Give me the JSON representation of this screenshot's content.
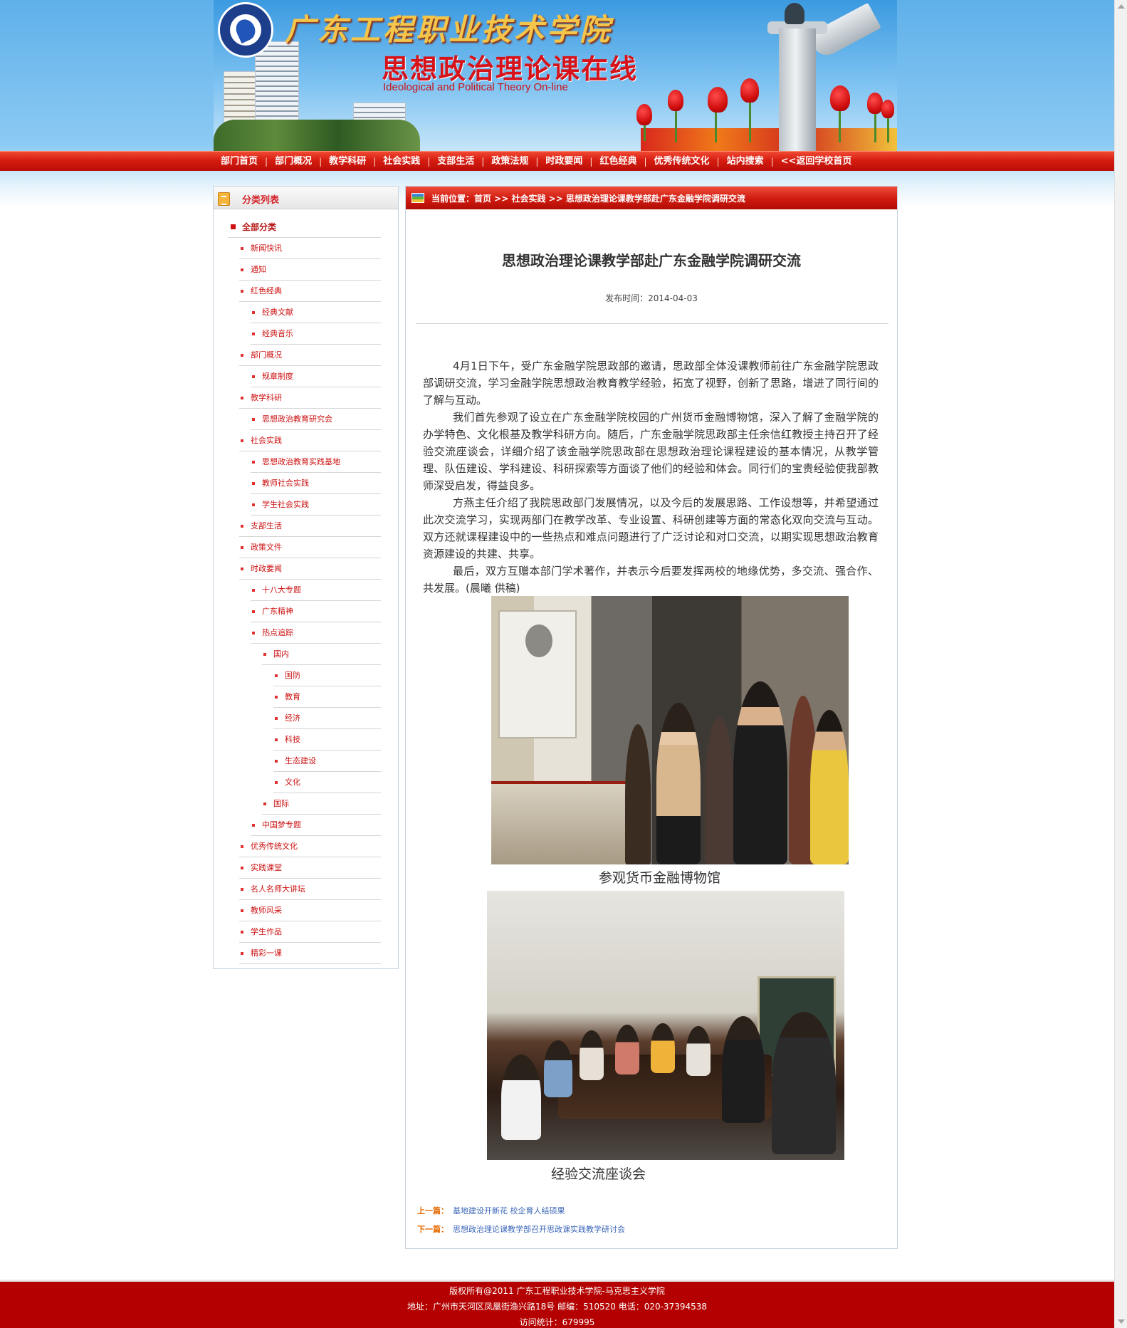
{
  "header": {
    "school_name": "广东工程职业技术学院",
    "site_title": "思想政治理论课在线",
    "site_subtitle": "Ideological and Political Theory On-line"
  },
  "nav": {
    "items": [
      "部门首页",
      "部门概况",
      "教学科研",
      "社会实践",
      "支部生活",
      "政策法规",
      "时政要闻",
      "红色经典",
      "优秀传统文化",
      "站内搜索",
      "<<返回学校首页"
    ]
  },
  "sidebar": {
    "title": "分类列表",
    "items": [
      {
        "label": "全部分类",
        "level": 0
      },
      {
        "label": "新闻快讯",
        "level": 1
      },
      {
        "label": "通知",
        "level": 1
      },
      {
        "label": "红色经典",
        "level": 1
      },
      {
        "label": "经典文献",
        "level": 2
      },
      {
        "label": "经典音乐",
        "level": 2
      },
      {
        "label": "部门概况",
        "level": 1
      },
      {
        "label": "规章制度",
        "level": 2
      },
      {
        "label": "教学科研",
        "level": 1
      },
      {
        "label": "思想政治教育研究会",
        "level": 2
      },
      {
        "label": "社会实践",
        "level": 1
      },
      {
        "label": "思想政治教育实践基地",
        "level": 2
      },
      {
        "label": "教师社会实践",
        "level": 2
      },
      {
        "label": "学生社会实践",
        "level": 2
      },
      {
        "label": "支部生活",
        "level": 1
      },
      {
        "label": "政策文件",
        "level": 1
      },
      {
        "label": "时政要闻",
        "level": 1
      },
      {
        "label": "十八大专题",
        "level": 2
      },
      {
        "label": "广东精神",
        "level": 2
      },
      {
        "label": "热点追踪",
        "level": 2
      },
      {
        "label": "国内",
        "level": 3
      },
      {
        "label": "国防",
        "level": 4
      },
      {
        "label": "教育",
        "level": 4
      },
      {
        "label": "经济",
        "level": 4
      },
      {
        "label": "科技",
        "level": 4
      },
      {
        "label": "生态建设",
        "level": 4
      },
      {
        "label": "文化",
        "level": 4
      },
      {
        "label": "国际",
        "level": 3
      },
      {
        "label": "中国梦专题",
        "level": 2
      },
      {
        "label": "优秀传统文化",
        "level": 1
      },
      {
        "label": "实践课堂",
        "level": 1
      },
      {
        "label": "名人名师大讲坛",
        "level": 1
      },
      {
        "label": "教师风采",
        "level": 1
      },
      {
        "label": "学生作品",
        "level": 1
      },
      {
        "label": "精彩一课",
        "level": 1
      }
    ]
  },
  "main": {
    "breadcrumb": "当前位置：首页 >> 社会实践 >> 思想政治理论课教学部赴广东金融学院调研交流",
    "title": "思想政治理论课教学部赴广东金融学院调研交流",
    "date": "发布时间：2014-04-03",
    "paragraphs": [
      "4月1日下午，受广东金融学院思政部的邀请，思政部全体没课教师前往广东金融学院思政部调研交流，学习金融学院思想政治教育教学经验，拓宽了视野，创新了思路，增进了同行间的了解与互动。",
      "我们首先参观了设立在广东金融学院校园的广州货币金融博物馆，深入了解了金融学院的办学特色、文化根基及教学科研方向。随后，广东金融学院思政部主任余信红教授主持召开了经验交流座谈会，详细介绍了该金融学院思政部在思想政治理论课程建设的基本情况，从教学管理、队伍建设、学科建设、科研探索等方面谈了他们的经验和体会。同行们的宝贵经验使我部教师深受启发，得益良多。",
      "方燕主任介绍了我院思政部门发展情况，以及今后的发展思路、工作设想等，并希望通过此次交流学习，实现两部门在教学改革、专业设置、科研创建等方面的常态化双向交流与互动。双方还就课程建设中的一些热点和难点问题进行了广泛讨论和对口交流，以期实现思想政治教育资源建设的共建、共享。",
      "最后，双方互赠本部门学术著作，并表示今后要发挥两校的地缘优势，多交流、强合作、共发展。(晨曦 供稿)"
    ],
    "captions": [
      "参观货币金融博物馆",
      "经验交流座谈会"
    ],
    "prev_label": "上一篇：",
    "prev_link": "基地建设开新花 校企育人结硕果",
    "next_label": "下一篇：",
    "next_link": "思想政治理论课教学部召开思政课实践教学研讨会"
  },
  "footer": {
    "copyright": "版权所有@2011 广东工程职业技术学院-马克思主义学院",
    "address": "地址：广州市天河区凤凰街渔兴路18号  邮编：510520  电话：020-37394538",
    "visits": "访问统计：679995"
  },
  "colors": {
    "nav_red": "#d61c11",
    "footer_red": "#b40000",
    "sidebar_text": "#cc1111",
    "prev_next_label": "#e66a00",
    "link_blue": "#3a66b8"
  }
}
